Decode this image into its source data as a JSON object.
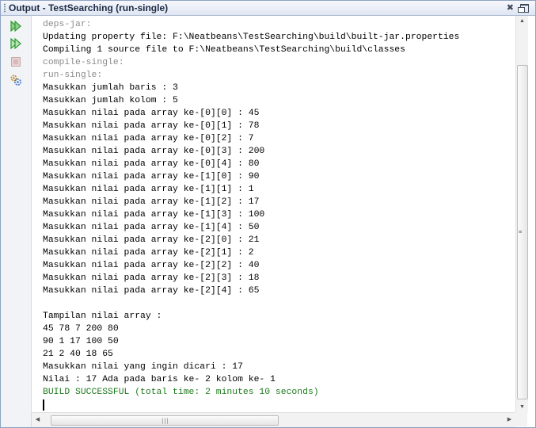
{
  "window": {
    "title": "Output - TestSearching (run-single)",
    "close_glyph": "✖",
    "controls": [
      "close-icon",
      "maximize-icon"
    ]
  },
  "toolbar": {
    "buttons": [
      {
        "icon": "rerun-icon",
        "color": "#2f9a2f"
      },
      {
        "icon": "rerun-with-options-icon",
        "color": "#2f9a2f"
      },
      {
        "icon": "stop-icon",
        "color": "#c9a9a9"
      },
      {
        "icon": "settings-icon",
        "color": "#3a74c4"
      }
    ]
  },
  "output": {
    "lines": [
      {
        "text": "deps-jar:",
        "style": "grey"
      },
      {
        "text": "Updating property file: F:\\Neatbeans\\TestSearching\\build\\built-jar.properties",
        "style": "normal"
      },
      {
        "text": "Compiling 1 source file to F:\\Neatbeans\\TestSearching\\build\\classes",
        "style": "normal"
      },
      {
        "text": "compile-single:",
        "style": "grey"
      },
      {
        "text": "run-single:",
        "style": "grey"
      },
      {
        "text": "Masukkan jumlah baris : 3",
        "style": "normal"
      },
      {
        "text": "Masukkan jumlah kolom : 5",
        "style": "normal"
      },
      {
        "text": "Masukkan nilai pada array ke-[0][0] : 45",
        "style": "normal"
      },
      {
        "text": "Masukkan nilai pada array ke-[0][1] : 78",
        "style": "normal"
      },
      {
        "text": "Masukkan nilai pada array ke-[0][2] : 7",
        "style": "normal"
      },
      {
        "text": "Masukkan nilai pada array ke-[0][3] : 200",
        "style": "normal"
      },
      {
        "text": "Masukkan nilai pada array ke-[0][4] : 80",
        "style": "normal"
      },
      {
        "text": "Masukkan nilai pada array ke-[1][0] : 90",
        "style": "normal"
      },
      {
        "text": "Masukkan nilai pada array ke-[1][1] : 1",
        "style": "normal"
      },
      {
        "text": "Masukkan nilai pada array ke-[1][2] : 17",
        "style": "normal"
      },
      {
        "text": "Masukkan nilai pada array ke-[1][3] : 100",
        "style": "normal"
      },
      {
        "text": "Masukkan nilai pada array ke-[1][4] : 50",
        "style": "normal"
      },
      {
        "text": "Masukkan nilai pada array ke-[2][0] : 21",
        "style": "normal"
      },
      {
        "text": "Masukkan nilai pada array ke-[2][1] : 2",
        "style": "normal"
      },
      {
        "text": "Masukkan nilai pada array ke-[2][2] : 40",
        "style": "normal"
      },
      {
        "text": "Masukkan nilai pada array ke-[2][3] : 18",
        "style": "normal"
      },
      {
        "text": "Masukkan nilai pada array ke-[2][4] : 65",
        "style": "normal"
      },
      {
        "text": "",
        "style": "normal"
      },
      {
        "text": "Tampilan nilai array :",
        "style": "normal"
      },
      {
        "text": "45 78 7 200 80",
        "style": "normal"
      },
      {
        "text": "90 1 17 100 50",
        "style": "normal"
      },
      {
        "text": "21 2 40 18 65",
        "style": "normal"
      },
      {
        "text": "Masukkan nilai yang ingin dicari : 17",
        "style": "normal"
      },
      {
        "text": "Nilai : 17 Ada pada baris ke- 2 kolom ke- 1",
        "style": "normal"
      },
      {
        "text": "BUILD SUCCESSFUL (total time: 2 minutes 10 seconds)",
        "style": "green"
      }
    ]
  },
  "scrollbars": {
    "vertical_grip": "≡",
    "horizontal_grip": "|||",
    "up_arrow": "▲",
    "down_arrow": "▼",
    "left_arrow": "◀",
    "right_arrow": "▶"
  }
}
